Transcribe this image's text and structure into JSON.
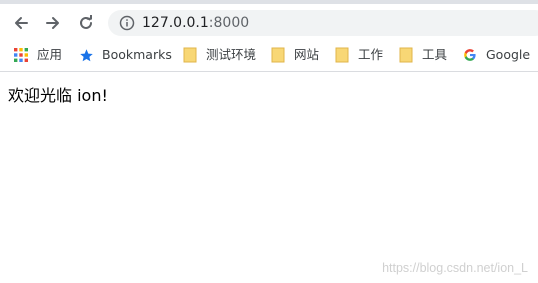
{
  "browser": {
    "nav": {
      "back": "back-arrow",
      "forward": "forward-arrow",
      "reload": "reload"
    },
    "address": {
      "host": "127.0.0.1",
      "port": ":8000"
    }
  },
  "bookmarks": [
    {
      "label": "应用",
      "icon": "apps-grid"
    },
    {
      "label": "Bookmarks",
      "icon": "star"
    },
    {
      "label": "测试环境",
      "icon": "folder"
    },
    {
      "label": "网站",
      "icon": "folder"
    },
    {
      "label": "工作",
      "icon": "folder"
    },
    {
      "label": "工具",
      "icon": "folder"
    },
    {
      "label": "Google",
      "icon": "google-g"
    }
  ],
  "page": {
    "message": "欢迎光临 ion!"
  },
  "watermark": "https://blog.csdn.net/ion_L",
  "colors": {
    "star": "#1a73e8",
    "folder": "#f8d775",
    "omnibox_bg": "#f1f3f4",
    "separator": "#dadce0"
  }
}
